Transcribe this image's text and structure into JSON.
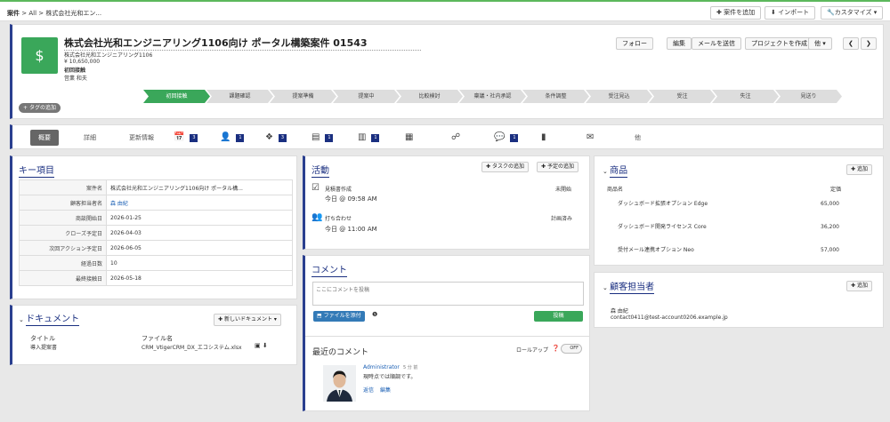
{
  "breadcrumb": {
    "root": "案件",
    "sep1": ">",
    "all": "All",
    "sep2": ">",
    "current": "株式会社光和エン..."
  },
  "topbar": {
    "add_case": "案件を追加",
    "import": "インポート",
    "customize": "カスタマイズ"
  },
  "record": {
    "title": "株式会社光和エンジニアリング1106向け ポータル構築案件 01543",
    "company": "株式会社光和エンジニアリング1106",
    "amount": "¥ 10,650,000",
    "stage_label": "初回接触",
    "owner": "営業 和夫",
    "buttons": {
      "follow": "フォロー",
      "edit": "編集",
      "send_mail": "メールを送信",
      "create_project": "プロジェクトを作成",
      "more": "他"
    },
    "stages": [
      "初回接触",
      "課題確認",
      "提案準備",
      "提案中",
      "比較検討",
      "稟議・社内承認",
      "条件調整",
      "受注見込",
      "受注",
      "失注",
      "見送り"
    ],
    "active_stage": 0,
    "add_tag": "タグの追加"
  },
  "tabs": {
    "summary": "概要",
    "detail": "詳細",
    "updates": "更新情報",
    "calendar_count": "3",
    "contacts_count": "1",
    "products_count": "3",
    "docs_count": "1",
    "doc2_count": "1",
    "comments_count": "1",
    "other": "他"
  },
  "key_items": {
    "title": "キー項目",
    "rows": [
      {
        "label": "案件名",
        "value": "株式会社光和エンジニアリング1106向け ポータル構..."
      },
      {
        "label": "顧客担当者名",
        "value": "森 由紀"
      },
      {
        "label": "商談開始日",
        "value": "2026-01-25"
      },
      {
        "label": "クローズ予定日",
        "value": "2026-04-03"
      },
      {
        "label": "次回アクション予定日",
        "value": "2026-06-05"
      },
      {
        "label": "経過日数",
        "value": "10"
      },
      {
        "label": "最終接触日",
        "value": "2026-05-18"
      }
    ]
  },
  "documents": {
    "title": "ドキュメント",
    "new_button": "新しいドキュメント",
    "col_title": "タイトル",
    "col_filename": "ファイル名",
    "row_title": "導入提案書",
    "row_filename": "CRM_VtigerCRM_DX_エコシステム.xlsx"
  },
  "activities": {
    "title": "活動",
    "add_task": "タスクの追加",
    "add_event": "予定の追加",
    "items": [
      {
        "name": "見積書作成",
        "time": "今日 @ 09:58 AM",
        "status": "未開始"
      },
      {
        "name": "打ち合わせ",
        "time": "今日 @ 11:00 AM",
        "status": "計画済み"
      }
    ]
  },
  "comments": {
    "title": "コメント",
    "placeholder": "ここにコメントを投稿",
    "attach": "ファイルを添付",
    "post": "投稿",
    "recent_title": "最近のコメント",
    "rollup": "ロールアップ",
    "toggle": "OFF",
    "author": "Administrator",
    "ago": "5 分 前",
    "text": "現時点では順調です。",
    "reply": "返信",
    "edit": "編集"
  },
  "products": {
    "title": "商品",
    "add": "追加",
    "col_name": "商品名",
    "col_price": "定価",
    "rows": [
      {
        "name": "ダッシュボード拡張オプション Edge",
        "price": "65,000"
      },
      {
        "name": "ダッシュボード開発ライセンス Core",
        "price": "36,200"
      },
      {
        "name": "受付メール連携オプション Neo",
        "price": "57,000"
      }
    ]
  },
  "contacts": {
    "title": "顧客担当者",
    "add": "追加",
    "name": "森 由紀",
    "email": "contact0411@test-account0206.example.jp"
  }
}
